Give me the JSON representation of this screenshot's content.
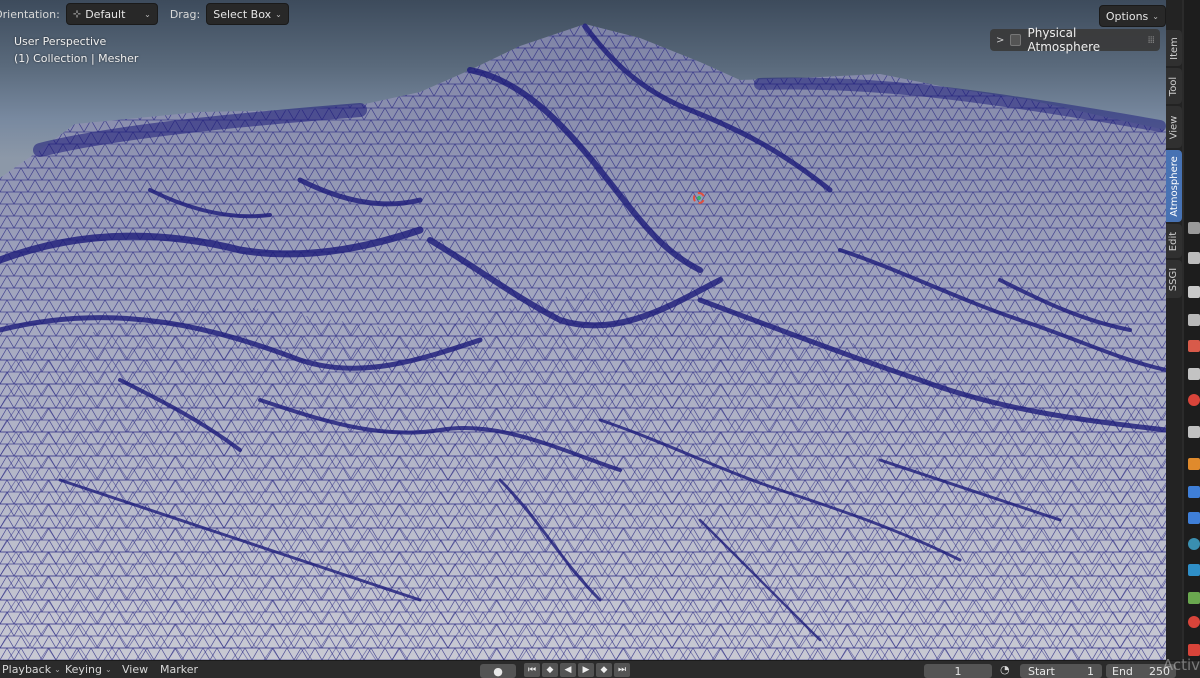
{
  "header": {
    "orientation_label": "Orientation:",
    "orientation_value": "Default",
    "drag_label": "Drag:",
    "drag_value": "Select Box",
    "options_label": "Options"
  },
  "viewport": {
    "perspective": "User Perspective",
    "collection": "(1) Collection | Mesher",
    "panel_title": "Physical Atmosphere"
  },
  "sidebar_tabs": [
    {
      "label": "Item",
      "active": false
    },
    {
      "label": "Tool",
      "active": false
    },
    {
      "label": "View",
      "active": false
    },
    {
      "label": "Atmosphere",
      "active": true
    },
    {
      "label": "Edit",
      "active": false
    },
    {
      "label": "SSGI",
      "active": false
    }
  ],
  "timeline": {
    "playback": "Playback",
    "keying": "Keying",
    "view": "View",
    "marker": "Marker",
    "current_frame": "1",
    "start_label": "Start",
    "start_value": "1",
    "end_label": "End",
    "end_value": "250"
  },
  "watermark": "Activ",
  "colors": {
    "wire": "#1c1b7a",
    "mesh_light": "#c9cad3",
    "active_tab": "#4772b3"
  },
  "icons": [
    "orientation-icon",
    "chevron-right-icon",
    "checkbox-icon",
    "drag-grip-icon",
    "object-origin-icon",
    "record-icon",
    "jump-start-icon",
    "keyframe-prev-icon",
    "play-reverse-icon",
    "play-icon",
    "keyframe-next-icon",
    "jump-end-icon",
    "stopwatch-icon"
  ]
}
